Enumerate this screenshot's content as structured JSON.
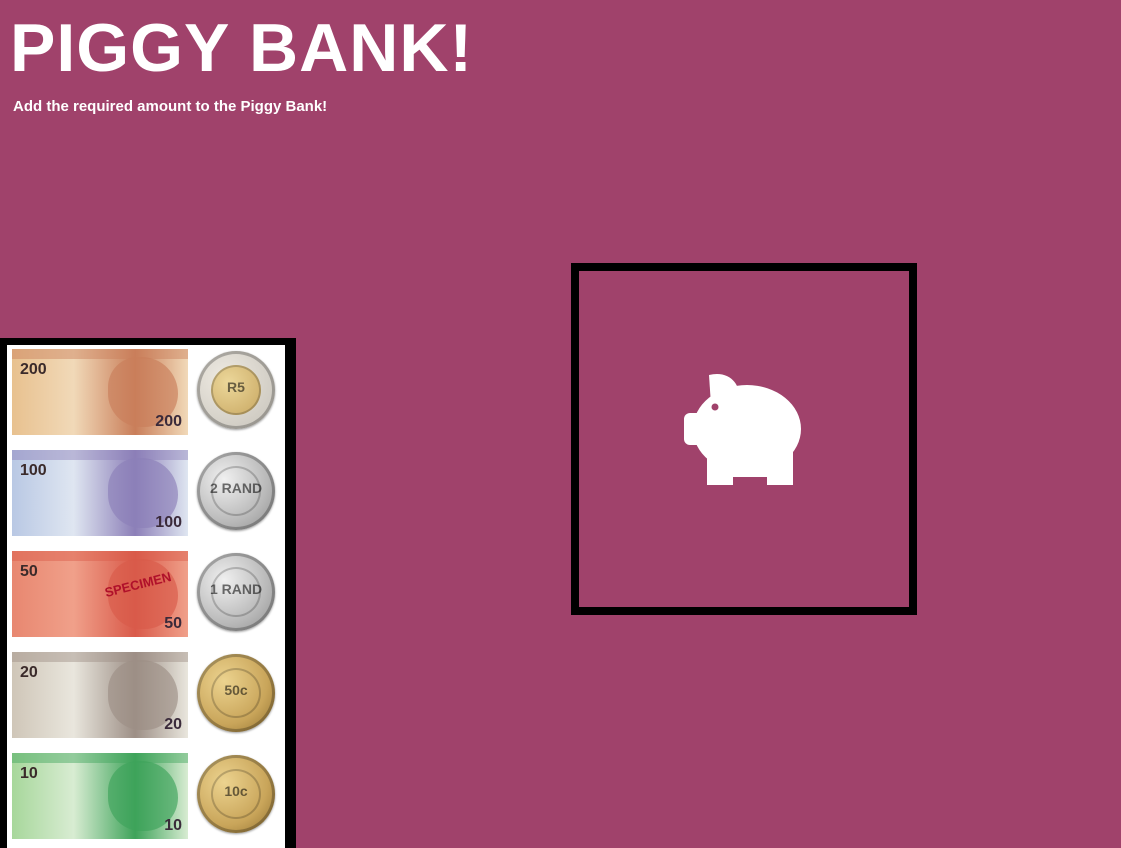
{
  "header": {
    "title": "PIGGY BANK!",
    "subtitle": "Add the required amount to the Piggy Bank!"
  },
  "money": [
    {
      "note": "200",
      "note_colors": [
        "#f1d9b8",
        "#c97e5a",
        "#e8c18f"
      ],
      "coin": "R5",
      "coin_type": "bimetal"
    },
    {
      "note": "100",
      "note_colors": [
        "#dfe6f1",
        "#8c7fb8",
        "#b9c8e4"
      ],
      "coin": "2 RAND",
      "coin_type": "silver"
    },
    {
      "note": "50",
      "note_colors": [
        "#f0a08a",
        "#d95a4a",
        "#e88770"
      ],
      "coin": "1 RAND",
      "coin_type": "silver",
      "note_stamp": "SPECIMEN"
    },
    {
      "note": "20",
      "note_colors": [
        "#e9e6dd",
        "#9d8f86",
        "#cfc6b8"
      ],
      "coin": "50c",
      "coin_type": "gold"
    },
    {
      "note": "10",
      "note_colors": [
        "#d8ecd2",
        "#3ea35a",
        "#a7d79b"
      ],
      "coin": "10c",
      "coin_type": "gold"
    }
  ],
  "colors": {
    "background": "#a0426b",
    "silver": "#b9b9b9",
    "gold": "#c9a55a",
    "bimetal_outer": "#c5c1b8",
    "bimetal_inner": "#c7a660"
  },
  "piggy_bank": {
    "icon": "piggy-bank-icon"
  }
}
